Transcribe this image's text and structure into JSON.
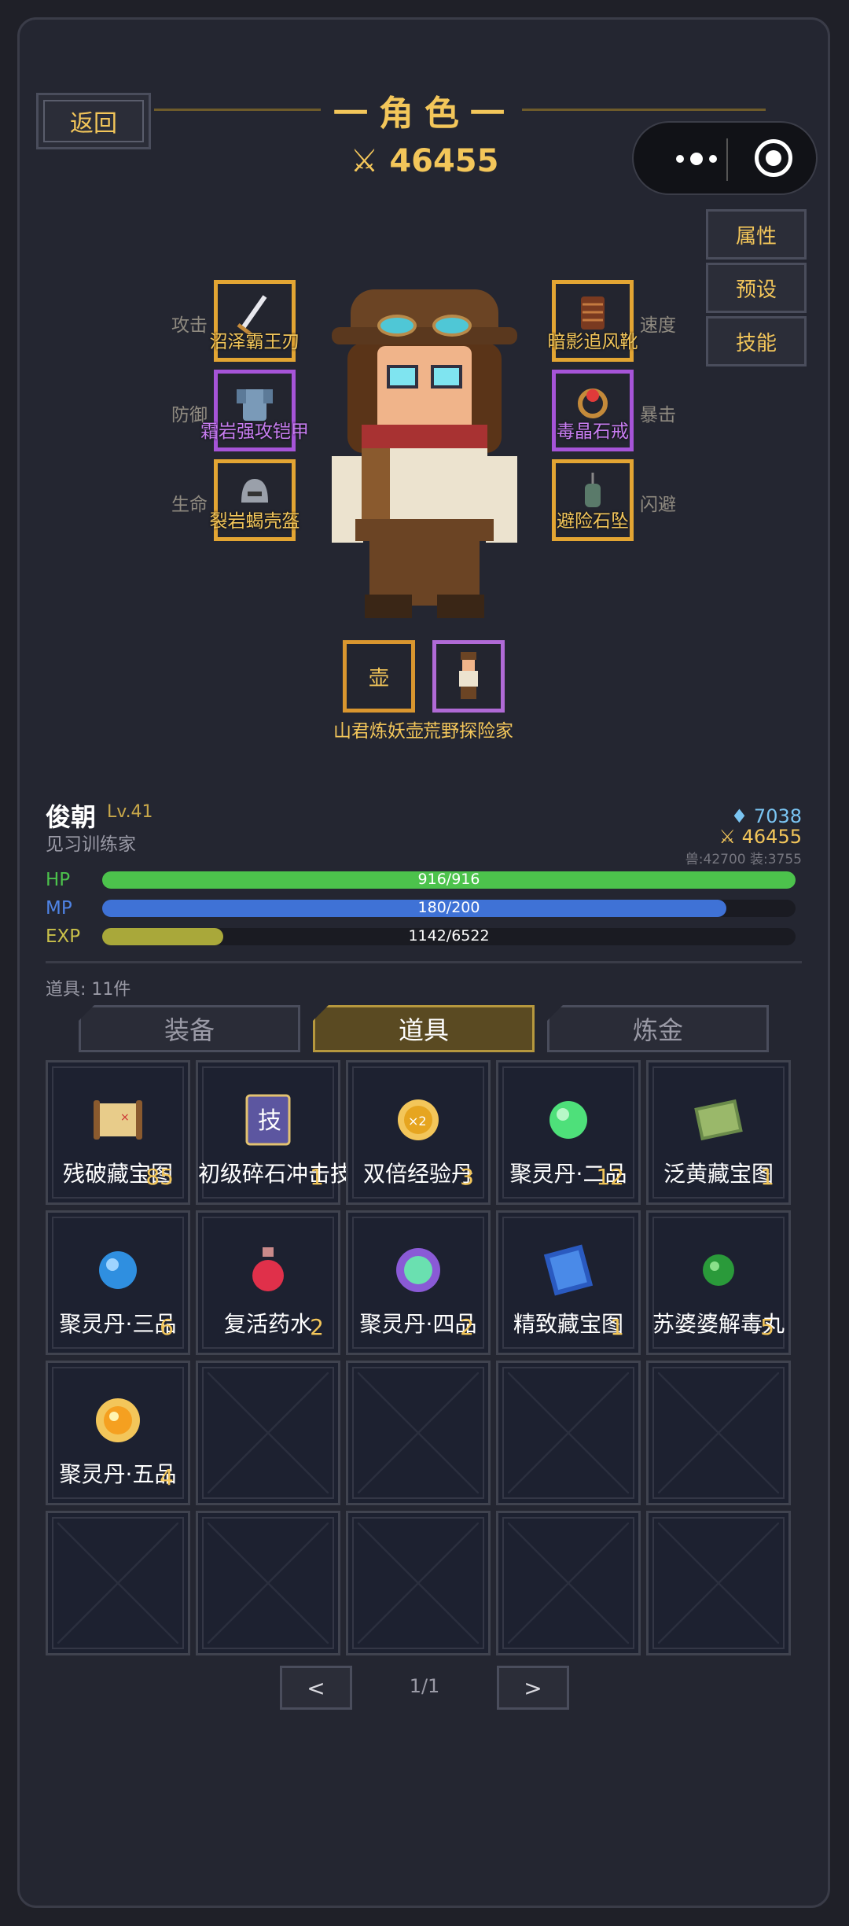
{
  "header": {
    "back_label": "返回",
    "title": "一角色一",
    "power": "46455"
  },
  "side_buttons": [
    "属性",
    "预设",
    "技能"
  ],
  "equipment": {
    "attack": {
      "label": "攻击",
      "item": "沼泽霸王刃",
      "rarity": "orange"
    },
    "defense": {
      "label": "防御",
      "item": "霜岩强攻铠甲",
      "rarity": "purple"
    },
    "life": {
      "label": "生命",
      "item": "裂岩蝎壳盔",
      "rarity": "orange"
    },
    "speed": {
      "label": "速度",
      "item": "暗影追风靴",
      "rarity": "orange"
    },
    "crit": {
      "label": "暴击",
      "item": "毒晶石戒",
      "rarity": "purple"
    },
    "dodge": {
      "label": "闪避",
      "item": "避险石坠",
      "rarity": "orange"
    }
  },
  "sub_slots": {
    "left": {
      "glyph": "壶",
      "name": "山君炼妖壶"
    },
    "right": {
      "name": "荒野探险家"
    }
  },
  "player": {
    "name": "俊朝",
    "level": "Lv.41",
    "title": "见习训练家",
    "gems": "7038",
    "gold": "46455",
    "breakdown": "兽:42700 装:3755"
  },
  "stats": {
    "hp": {
      "label": "HP",
      "text": "916/916",
      "ratio": 1.0,
      "color": "#4cc24c"
    },
    "mp": {
      "label": "MP",
      "text": "180/200",
      "ratio": 0.9,
      "color": "#3f72d6"
    },
    "exp": {
      "label": "EXP",
      "text": "1142/6522",
      "ratio": 0.175,
      "color": "#a9a83a"
    }
  },
  "inventory": {
    "count_label": "道具: 11件",
    "tabs": [
      "装备",
      "道具",
      "炼金"
    ],
    "active_tab": 1,
    "items": [
      {
        "name": "残破藏宝图",
        "qty": "85",
        "icon": "scroll-map-icon"
      },
      {
        "name": "初级碎石冲击技",
        "qty": "1",
        "icon": "skill-book-icon"
      },
      {
        "name": "双倍经验丹",
        "qty": "3",
        "icon": "double-exp-icon"
      },
      {
        "name": "聚灵丹·二品",
        "qty": "12",
        "icon": "green-orb-icon"
      },
      {
        "name": "泛黄藏宝图",
        "qty": "1",
        "icon": "yellow-map-icon"
      },
      {
        "name": "聚灵丹·三品",
        "qty": "6",
        "icon": "blue-orb-icon"
      },
      {
        "name": "复活药水",
        "qty": "2",
        "icon": "potion-icon"
      },
      {
        "name": "聚灵丹·四品",
        "qty": "2",
        "icon": "purple-orb-icon"
      },
      {
        "name": "精致藏宝图",
        "qty": "1",
        "icon": "blue-map-icon"
      },
      {
        "name": "苏婆婆解毒丸",
        "qty": "5",
        "icon": "antidote-icon"
      },
      {
        "name": "聚灵丹·五品",
        "qty": "4",
        "icon": "gold-orb-icon"
      }
    ],
    "page": "1/1",
    "prev": "<",
    "next": ">"
  }
}
